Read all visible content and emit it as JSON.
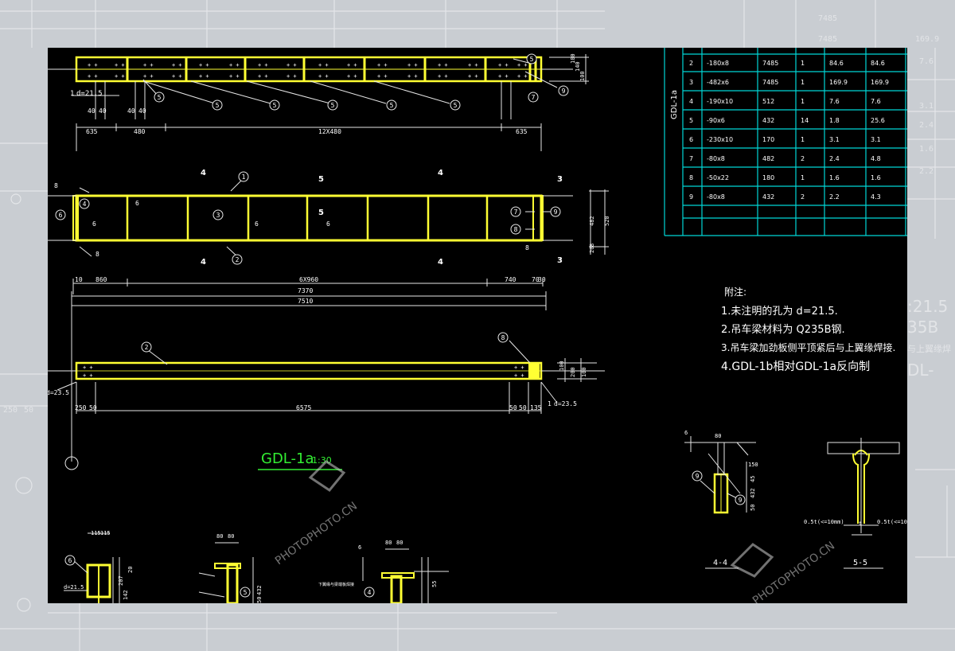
{
  "colors": {
    "background": "#000000",
    "beam": "#ffff33",
    "line_white": "#e6e6e6",
    "table_line": "#00d6d6",
    "title": "#33ee33",
    "outer": "#c9cdd2"
  },
  "plan_top": {
    "dims": [
      "635",
      "480",
      "12X480",
      "635"
    ],
    "dims_small": [
      "40",
      "40",
      "40",
      "40"
    ],
    "hole_label": "d=21.5",
    "bubbles": [
      "5",
      "5",
      "5",
      "5",
      "5",
      "5",
      "5",
      "7",
      "9"
    ],
    "right_dims": [
      "100",
      "140",
      "100"
    ]
  },
  "elevation": {
    "bubbles": [
      "1",
      "2",
      "3",
      "4",
      "6",
      "7",
      "8",
      "9"
    ],
    "section_marks": [
      "4",
      "4",
      "5",
      "5",
      "4",
      "4",
      "3",
      "3"
    ],
    "weld_sizes": [
      "8",
      "6",
      "6",
      "6",
      "8",
      "6",
      "8"
    ],
    "right_dims": [
      "482",
      "520",
      "20",
      "8"
    ],
    "dims_row1": [
      "10",
      "860",
      "6X960",
      "740",
      "70",
      "30"
    ],
    "dim_total1": "7370",
    "dim_total2": "7510"
  },
  "plan_bottom": {
    "bubbles": [
      "2",
      "8"
    ],
    "dims": [
      "250",
      "50",
      "6575",
      "50",
      "50",
      "135"
    ],
    "hole_left": "d=23.5",
    "hole_right": "d=23.5",
    "right_dims": [
      "100",
      "200",
      "100"
    ]
  },
  "title": {
    "label": "GDL-1a",
    "scale": "1:30",
    "watermark_text": "PHOTOPHOTO.CN"
  },
  "table": {
    "side_label": "GDL-1a",
    "rows": [
      [
        "2",
        "-180x8",
        "7485",
        "1",
        "84.6",
        "84.6"
      ],
      [
        "3",
        "-482x6",
        "7485",
        "1",
        "169.9",
        "169.9"
      ],
      [
        "4",
        "-190x10",
        "512",
        "1",
        "7.6",
        "7.6"
      ],
      [
        "5",
        "-90x6",
        "432",
        "14",
        "1.8",
        "25.6"
      ],
      [
        "6",
        "-230x10",
        "170",
        "1",
        "3.1",
        "3.1"
      ],
      [
        "7",
        "-80x8",
        "482",
        "2",
        "2.4",
        "4.8"
      ],
      [
        "8",
        "-50x22",
        "180",
        "1",
        "1.6",
        "1.6"
      ],
      [
        "9",
        "-80x8",
        "432",
        "2",
        "2.2",
        "4.3"
      ]
    ]
  },
  "notes": {
    "heading": "附注:",
    "items": [
      "1.未注明的孔为  d=21.5.",
      "2.吊车梁材料为  Q235B钢.",
      "3.吊车梁加劲板侧平顶紧后与上翼缘焊接.",
      "4.GDL-1b相对GDL-1a反向制"
    ]
  },
  "details": {
    "section_4_4": "4-4",
    "section_5_5": "5-5",
    "dims_44": [
      "6",
      "80",
      "45",
      "432",
      "50",
      "150"
    ],
    "bubbles_44": [
      "9",
      "9"
    ],
    "weld_55": [
      "0.5t(<=10mm)",
      "0.5t(<=10mm)"
    ],
    "thickness_55": "t"
  },
  "bottom_sections": {
    "dims_a": [
      "115",
      "115",
      "207",
      "142",
      "20"
    ],
    "hole": "d=21.5",
    "bubbles": [
      "6",
      "5",
      "4"
    ],
    "dims_b": [
      "80",
      "80",
      "432",
      "50"
    ],
    "dims_c": [
      "80",
      "80",
      "55",
      "6"
    ],
    "note_c": "下翼缘与梁端板焊接"
  },
  "outer": {
    "table_values": [
      "7485",
      "7485",
      "169.9",
      "7.6",
      "3.1",
      "2.4",
      "1.6",
      "2.2",
      "2.4"
    ],
    "fragments": [
      ":21.5",
      "35B",
      "与上翼缘焊",
      "DL-"
    ],
    "dims": [
      "250",
      "50"
    ]
  }
}
